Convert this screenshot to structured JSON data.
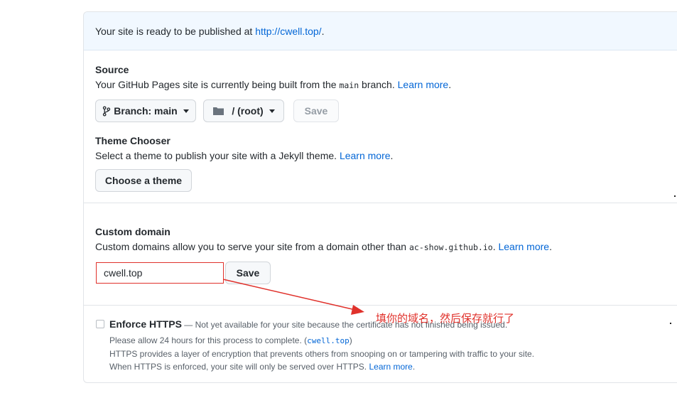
{
  "flash": {
    "text": "Your site is ready to be published at ",
    "url": "http://cwell.top/",
    "suffix": "."
  },
  "source": {
    "title": "Source",
    "desc_before": "Your GitHub Pages site is currently being built from the ",
    "branch_code": "main",
    "desc_after": " branch. ",
    "learn_more": "Learn more",
    "desc_end": ".",
    "branch_button": "Branch: main",
    "folder_button": "/ (root)",
    "save_button": "Save"
  },
  "theme": {
    "title": "Theme Chooser",
    "desc": "Select a theme to publish your site with a Jekyll theme. ",
    "learn_more": "Learn more",
    "desc_end": ".",
    "choose_button": "Choose a theme"
  },
  "custom_domain": {
    "title": "Custom domain",
    "desc_before": "Custom domains allow you to serve your site from a domain other than ",
    "code": "ac-show.github.io",
    "desc_after": ". ",
    "learn_more": "Learn more",
    "desc_end": ".",
    "input_value": "cwell.top",
    "save_button": "Save"
  },
  "https": {
    "title": "Enforce HTTPS",
    "dash": " — ",
    "note": "Not yet available for your site because the certificate has not finished being issued.",
    "line1_before": "Please allow 24 hours for this process to complete. (",
    "line1_code": "cwell.top",
    "line1_after": ")",
    "line2": "HTTPS provides a layer of encryption that prevents others from snooping on or tampering with traffic to your site.",
    "line3": "When HTTPS is enforced, your site will only be served over HTTPS. ",
    "learn_more": "Learn more",
    "line3_end": "."
  },
  "annotation": {
    "text": "填你的域名，然后保存就行了",
    "color": "#e0312b"
  },
  "icons": {
    "branch": "git-branch-icon",
    "folder": "folder-icon",
    "caret": "caret-down-icon",
    "arrow": "annotation-arrow"
  },
  "colors": {
    "link": "#0366d6",
    "flash_bg": "#f1f8ff",
    "annotation": "#e0312b"
  }
}
